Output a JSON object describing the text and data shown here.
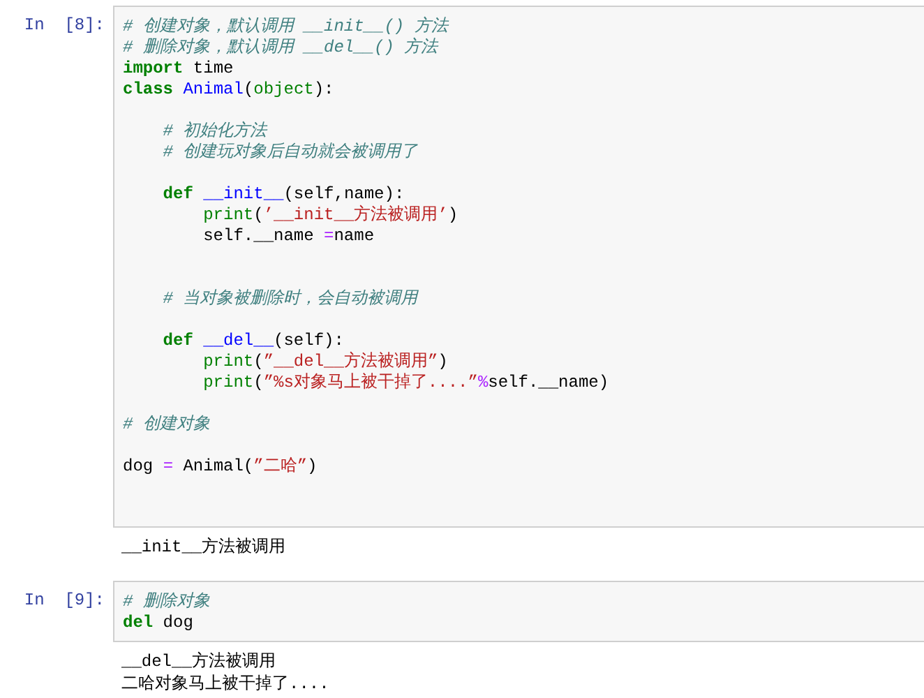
{
  "cells": [
    {
      "prompt": "In  [8]:",
      "lines": [
        {
          "kind": "code",
          "tokens": [
            {
              "kind": "comment",
              "text": "# 创建对象，默认调用 __init__() 方法"
            }
          ]
        },
        {
          "kind": "code",
          "tokens": [
            {
              "kind": "comment",
              "text": "# 删除对象，默认调用 __del__() 方法"
            }
          ]
        },
        {
          "kind": "code",
          "tokens": [
            {
              "kind": "keyword",
              "text": "import"
            },
            {
              "kind": "plain",
              "text": " time"
            }
          ]
        },
        {
          "kind": "code",
          "tokens": [
            {
              "kind": "keyword",
              "text": "class"
            },
            {
              "kind": "name",
              "text": " Animal"
            },
            {
              "kind": "plain",
              "text": "("
            },
            {
              "kind": "builtin",
              "text": "object"
            },
            {
              "kind": "plain",
              "text": "):"
            }
          ]
        },
        {
          "kind": "blank"
        },
        {
          "kind": "code",
          "tokens": [
            {
              "kind": "comment",
              "text": "    # 初始化方法"
            }
          ]
        },
        {
          "kind": "code",
          "tokens": [
            {
              "kind": "comment",
              "text": "    # 创建玩对象后自动就会被调用了"
            }
          ]
        },
        {
          "kind": "blank"
        },
        {
          "kind": "code",
          "tokens": [
            {
              "kind": "keyword",
              "text": "    def"
            },
            {
              "kind": "name",
              "text": " __init__"
            },
            {
              "kind": "plain",
              "text": "(self,name):"
            }
          ]
        },
        {
          "kind": "code",
          "tokens": [
            {
              "kind": "builtin",
              "text": "        print"
            },
            {
              "kind": "plain",
              "text": "("
            },
            {
              "kind": "string",
              "text": "’__init__方法被调用’"
            },
            {
              "kind": "plain",
              "text": ")"
            }
          ]
        },
        {
          "kind": "code",
          "tokens": [
            {
              "kind": "plain",
              "text": "        self.__name "
            },
            {
              "kind": "operator",
              "text": "="
            },
            {
              "kind": "plain",
              "text": "name"
            }
          ]
        },
        {
          "kind": "blank"
        },
        {
          "kind": "blank"
        },
        {
          "kind": "code",
          "tokens": [
            {
              "kind": "comment",
              "text": "    # 当对象被删除时，会自动被调用"
            }
          ]
        },
        {
          "kind": "blank"
        },
        {
          "kind": "code",
          "tokens": [
            {
              "kind": "keyword",
              "text": "    def"
            },
            {
              "kind": "name",
              "text": " __del__"
            },
            {
              "kind": "plain",
              "text": "(self):"
            }
          ]
        },
        {
          "kind": "code",
          "tokens": [
            {
              "kind": "builtin",
              "text": "        print"
            },
            {
              "kind": "plain",
              "text": "("
            },
            {
              "kind": "string",
              "text": "”__del__方法被调用”"
            },
            {
              "kind": "plain",
              "text": ")"
            }
          ]
        },
        {
          "kind": "code",
          "tokens": [
            {
              "kind": "builtin",
              "text": "        print"
            },
            {
              "kind": "plain",
              "text": "("
            },
            {
              "kind": "string",
              "text": "”%s对象马上被干掉了....”"
            },
            {
              "kind": "operator",
              "text": "%"
            },
            {
              "kind": "plain",
              "text": "self.__name)"
            }
          ]
        },
        {
          "kind": "blank"
        },
        {
          "kind": "code",
          "tokens": [
            {
              "kind": "comment",
              "text": "# 创建对象"
            }
          ]
        },
        {
          "kind": "blank"
        },
        {
          "kind": "code",
          "tokens": [
            {
              "kind": "plain",
              "text": "dog "
            },
            {
              "kind": "operator",
              "text": "="
            },
            {
              "kind": "plain",
              "text": " Animal("
            },
            {
              "kind": "string",
              "text": "”二哈”"
            },
            {
              "kind": "plain",
              "text": ")"
            }
          ]
        },
        {
          "kind": "blank"
        },
        {
          "kind": "blank"
        }
      ],
      "outputs": [
        "__init__方法被调用"
      ]
    },
    {
      "prompt": "In  [9]:",
      "lines": [
        {
          "kind": "code",
          "tokens": [
            {
              "kind": "comment",
              "text": "# 删除对象"
            }
          ]
        },
        {
          "kind": "code",
          "tokens": [
            {
              "kind": "keyword",
              "text": "del"
            },
            {
              "kind": "plain",
              "text": " dog"
            }
          ]
        }
      ],
      "outputs": [
        "__del__方法被调用",
        "二哈对象马上被干掉了...."
      ]
    }
  ]
}
